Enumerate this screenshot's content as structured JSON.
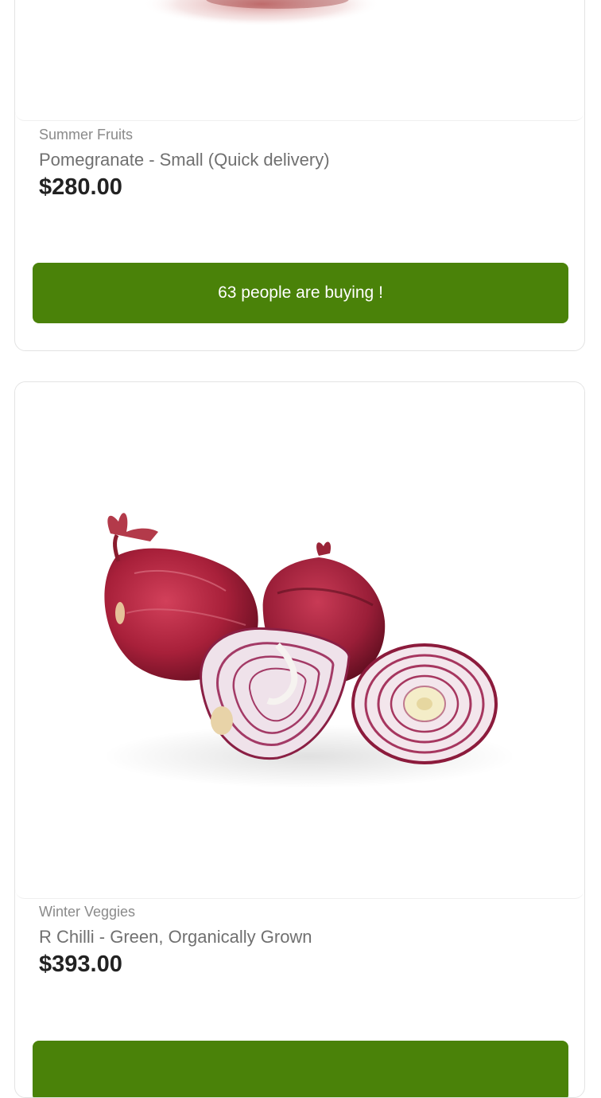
{
  "products": [
    {
      "category": "Summer Fruits",
      "name": "Pomegranate - Small (Quick delivery)",
      "price": "$280.00",
      "buy_label": "63 people are buying !",
      "image": "pomegranate-photo"
    },
    {
      "category": "Winter Veggies",
      "name": "R Chilli - Green, Organically Grown",
      "price": "$393.00",
      "buy_label": "",
      "image": "red-onion-photo"
    }
  ],
  "colors": {
    "button": "#4a8209",
    "price": "#222222",
    "title": "#707070",
    "category": "#8a8a8a",
    "card_border": "#e3e3e3"
  }
}
